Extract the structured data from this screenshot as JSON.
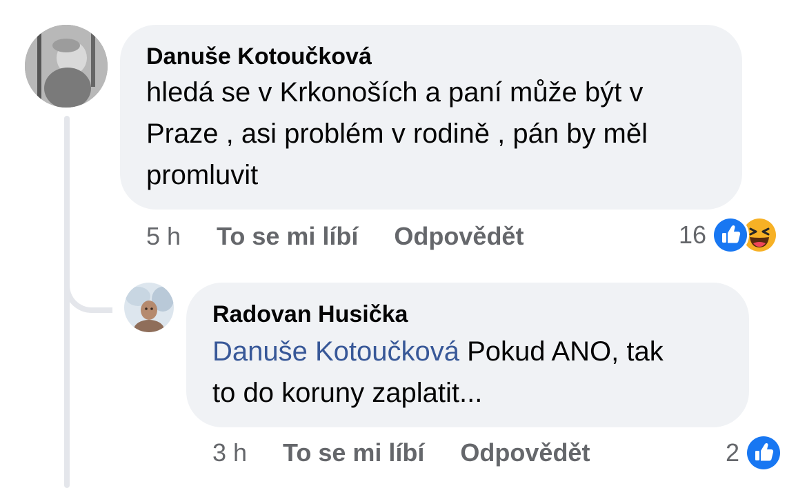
{
  "comments": [
    {
      "author": "Danuše Kotoučková",
      "text_lines": [
        "hledá se v Krkonoších a paní může být v",
        "Praze , asi problém v rodině , pán by měl",
        "promluvit"
      ],
      "time": "5 h",
      "like_label": "To se mi líbí",
      "reply_label": "Odpovědět",
      "reaction_count": "16",
      "reactions": [
        "like-icon",
        "haha-icon"
      ]
    },
    {
      "author": "Radovan Husička",
      "mention": "Danuše Kotoučková",
      "text_after_mention": " Pokud ANO, tak",
      "text_line2": "to do koruny zaplatit...",
      "time": "3 h",
      "like_label": "To se mi líbí",
      "reply_label": "Odpovědět",
      "reaction_count": "2",
      "reactions": [
        "like-icon"
      ]
    }
  ],
  "colors": {
    "bubble": "#f0f2f5",
    "meta_text": "#65676b",
    "mention": "#385898",
    "like_blue": "#1877f2",
    "haha_yellow": "#f7b125"
  }
}
